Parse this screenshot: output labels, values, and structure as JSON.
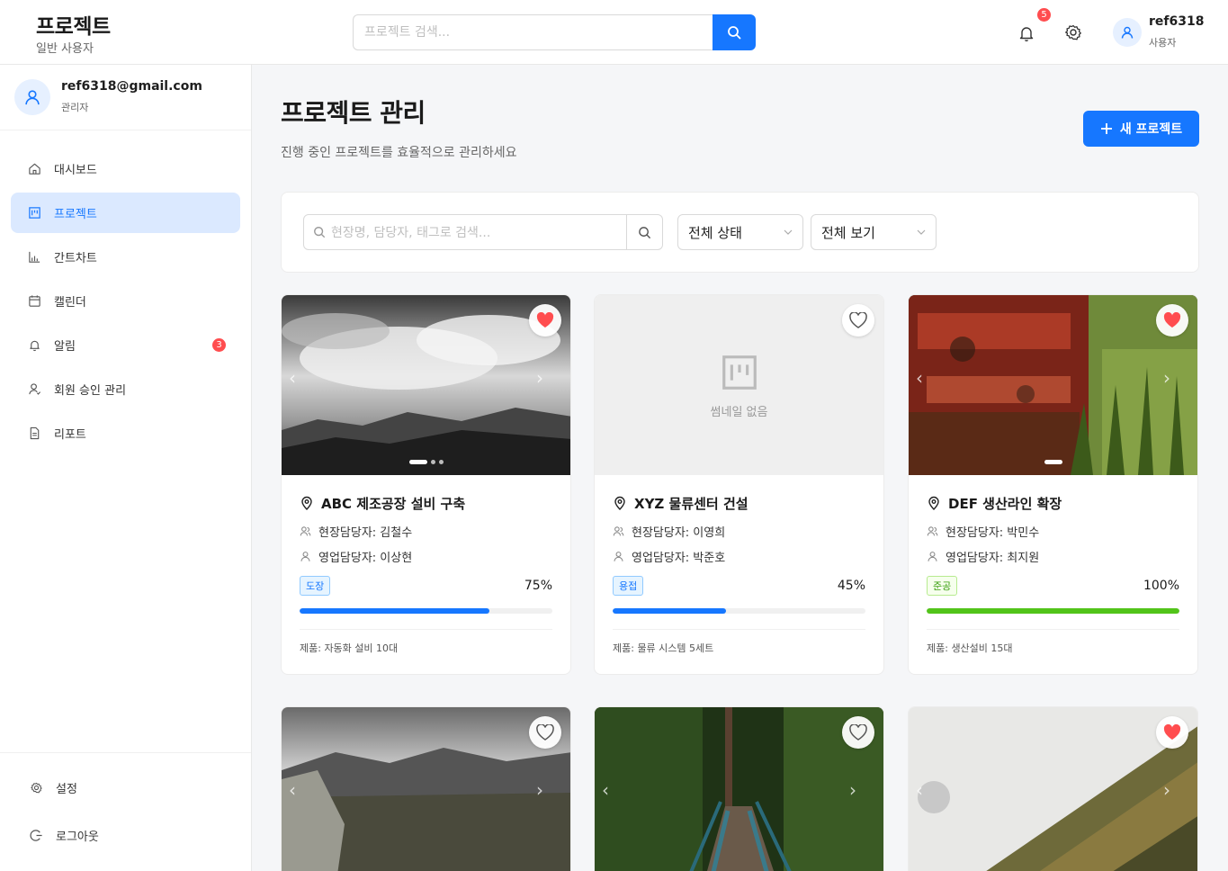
{
  "header": {
    "title": "프로젝트",
    "subtitle": "일반 사용자",
    "search_placeholder": "프로젝트 검색...",
    "notification_count": "5",
    "user_name": "ref6318",
    "user_role": "사용자"
  },
  "sidebar": {
    "email": "ref6318@gmail.com",
    "role": "관리자",
    "items": [
      {
        "label": "대시보드",
        "icon": "home-icon"
      },
      {
        "label": "프로젝트",
        "icon": "project-icon",
        "active": true
      },
      {
        "label": "간트차트",
        "icon": "bar-chart-icon"
      },
      {
        "label": "캘린더",
        "icon": "calendar-icon"
      },
      {
        "label": "알림",
        "icon": "bell-icon",
        "badge": "3"
      },
      {
        "label": "회원 승인 관리",
        "icon": "user-icon"
      },
      {
        "label": "리포트",
        "icon": "file-icon"
      }
    ],
    "bottom": [
      {
        "label": "설정",
        "icon": "gear-icon"
      },
      {
        "label": "로그아웃",
        "icon": "logout-icon"
      }
    ]
  },
  "main": {
    "title": "프로젝트 관리",
    "subtitle": "진행 중인 프로젝트를 효율적으로 관리하세요",
    "new_button": "새 프로젝트",
    "filter": {
      "search_placeholder": "현장명, 담당자, 태그로 검색...",
      "status_value": "전체 상태",
      "view_value": "전체 보기"
    },
    "cards": [
      {
        "title": "ABC 제조공장 설비 구축",
        "site_manager": "현장담당자: 김철수",
        "sales_manager": "영업담당자: 이상현",
        "tag": "도장",
        "tag_color": "blue",
        "progress_label": "75%",
        "progress": 0.75,
        "bar_color": "#1677ff",
        "product": "제품: 자동화 설비 10대",
        "favorite": true
      },
      {
        "title": "XYZ 물류센터 건설",
        "site_manager": "현장담당자: 이영희",
        "sales_manager": "영업담당자: 박준호",
        "tag": "용접",
        "tag_color": "blue",
        "progress_label": "45%",
        "progress": 0.45,
        "bar_color": "#1677ff",
        "product": "제품: 물류 시스템 5세트",
        "favorite": false,
        "no_thumbnail": "썸네일 없음"
      },
      {
        "title": "DEF 생산라인 확장",
        "site_manager": "현장담당자: 박민수",
        "sales_manager": "영업담당자: 최지원",
        "tag": "준공",
        "tag_color": "green",
        "progress_label": "100%",
        "progress": 1.0,
        "bar_color": "#52c41a",
        "product": "제품: 생산설비 15대",
        "favorite": true
      }
    ],
    "second_row_favorites": [
      false,
      false,
      true
    ]
  }
}
